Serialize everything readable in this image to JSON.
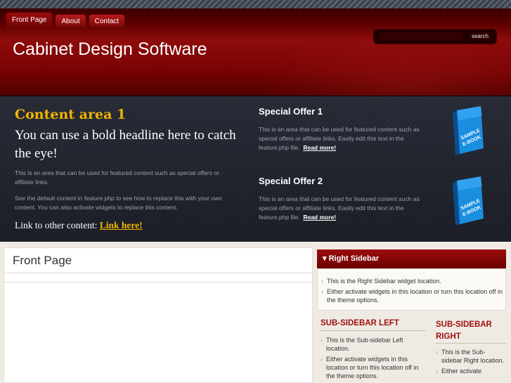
{
  "nav": {
    "tabs": [
      {
        "label": "Front Page"
      },
      {
        "label": "About"
      },
      {
        "label": "Contact"
      }
    ]
  },
  "header": {
    "site_title": "Cabinet Design Software",
    "search_button": "search"
  },
  "feature": {
    "content_area_title": "Content area 1",
    "headline": "You can use a bold headline here to catch the eye!",
    "paragraph1": "This is an area that can be used for featured content such as special offers or affiliate links.",
    "paragraph2": "See the default content in feature.php to see how to replace this with your own content. You can also activate widgets to replace this content.",
    "link_prefix": "Link to other content:",
    "link_text": "Link here!",
    "offers": [
      {
        "title": "Special Offer 1",
        "text": "This is an area that can be used for featured content such as special offers or affiliate links. Easily edit this text in the feature.php file.",
        "link": "Read more!",
        "book_label": "SAMPLE E-BOOK"
      },
      {
        "title": "Special Offer 2",
        "text": "This is an area that can be used for featured content such as special offers or affiliate links. Easily edit this text in the feature.php file.",
        "link": "Read more!",
        "book_label": "SAMPLE E-BOOK"
      }
    ]
  },
  "main": {
    "page_title": "Front Page"
  },
  "right_sidebar": {
    "title": "Right Sidebar",
    "items": [
      "This is the Right Sidebar widget location.",
      "Either activate widgets in this location or turn this location off in the theme options."
    ]
  },
  "sub_sidebar_left": {
    "title": "SUB-SIDEBAR LEFT",
    "items": [
      "This is the Sub-sidebar Left location.",
      "Either activate widgets in this location or turn this location off in the theme options."
    ]
  },
  "sub_sidebar_right": {
    "title": "SUB-SIDEBAR RIGHT",
    "items": [
      "This is the Sub-sidebar Right location.",
      "Either activate"
    ]
  },
  "colors": {
    "brand_red": "#8e0b0b",
    "accent_gold": "#f0b400",
    "feature_bg": "#1f232d"
  }
}
